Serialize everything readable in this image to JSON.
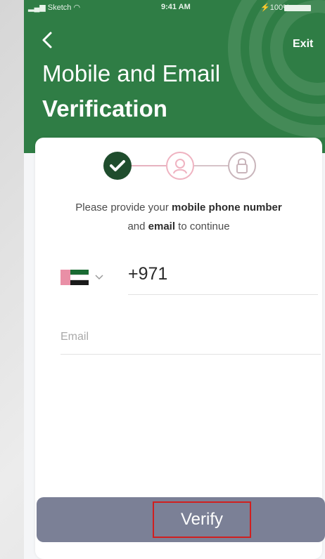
{
  "status_bar": {
    "carrier": "Sketch",
    "time": "9:41 AM",
    "battery": "100%"
  },
  "header": {
    "title_line1": "Mobile and Email",
    "title_line2": "Verification",
    "exit_label": "Exit"
  },
  "colors": {
    "header_green": "#2f7d45",
    "step_done": "#1f4d2d",
    "step_inactive_pink": "#efb3c1",
    "verify_button": "#7b8096",
    "highlight_red": "#d01f1f"
  },
  "steps": [
    {
      "icon": "check-icon",
      "state": "done"
    },
    {
      "icon": "user-icon",
      "state": "pending"
    },
    {
      "icon": "lock-icon",
      "state": "pending"
    }
  ],
  "instruction": {
    "prefix": "Please provide your ",
    "bold1": "mobile phone number",
    "middle": "and ",
    "bold2": "email",
    "suffix": " to continue"
  },
  "phone": {
    "country_code": "+971",
    "flag_icon": "uae-flag-icon"
  },
  "email": {
    "placeholder": "Email",
    "value": ""
  },
  "verify_button": {
    "label": "Verify"
  }
}
